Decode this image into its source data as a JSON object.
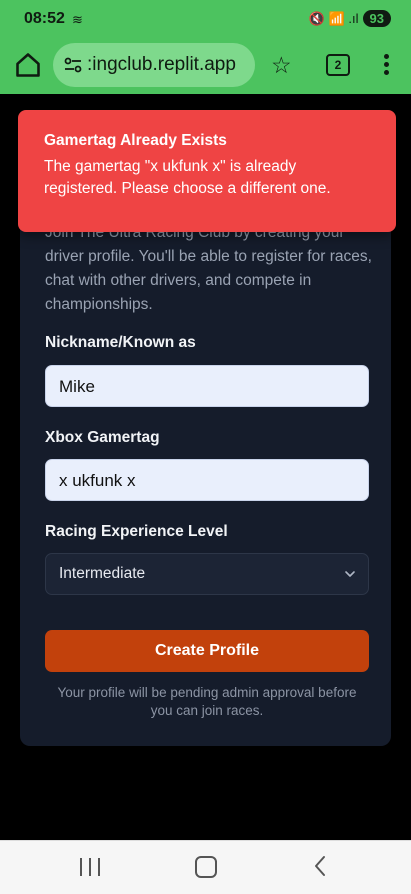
{
  "status": {
    "time": "08:52",
    "battery": "93",
    "cast_glyph": "≋",
    "system_glyphs": "🔇 📶 .ıl"
  },
  "browser": {
    "url": ":ingclub.replit.app",
    "tab_count": "2",
    "star_glyph": "☆"
  },
  "toast": {
    "title": "Gamertag Already Exists",
    "message": "The gamertag \"x ukfunk x\" is already registered. Please choose a different one."
  },
  "form": {
    "intro": "Join The Ultra Racing Club by creating your driver profile. You'll be able to register for races, chat with other drivers, and compete in championships.",
    "nickname_label": "Nickname/Known as",
    "nickname_value": "Mike",
    "gamertag_label": "Xbox Gamertag",
    "gamertag_value": "x ukfunk x",
    "experience_label": "Racing Experience Level",
    "experience_value": "Intermediate",
    "submit_label": "Create Profile",
    "note": "Your profile will be pending admin approval before you can join races."
  },
  "icons": {
    "home": "home-icon",
    "site_settings": "tune-icon",
    "bookmark": "star-icon",
    "tabs": "tabs-icon",
    "menu": "more-vert-icon",
    "chevron": "chevron-down-icon",
    "nav_recents": "recents-icon",
    "nav_home": "home-circle-icon",
    "nav_back": "back-icon"
  },
  "colors": {
    "accent_bar": "#4cc35f",
    "toast_bg": "#ef4444",
    "cta_bg": "#c2410c",
    "card_bg": "#151c2b"
  }
}
